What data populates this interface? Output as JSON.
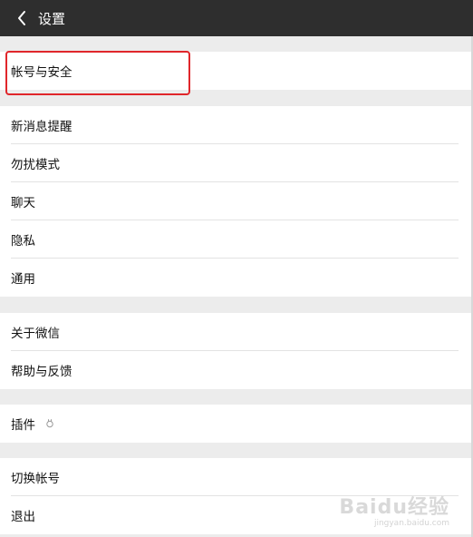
{
  "header": {
    "title": "设置",
    "back_icon": "chevron-left-icon"
  },
  "groups": [
    {
      "items": [
        {
          "label": "帐号与安全"
        }
      ]
    },
    {
      "items": [
        {
          "label": "新消息提醒"
        },
        {
          "label": "勿扰模式"
        },
        {
          "label": "聊天"
        },
        {
          "label": "隐私"
        },
        {
          "label": "通用"
        }
      ]
    },
    {
      "items": [
        {
          "label": "关于微信"
        },
        {
          "label": "帮助与反馈"
        }
      ]
    },
    {
      "items": [
        {
          "label": "插件",
          "icon": "plugin-icon"
        }
      ]
    },
    {
      "items": [
        {
          "label": "切换帐号"
        },
        {
          "label": "退出"
        }
      ]
    }
  ],
  "watermark": {
    "main": "Baidu经验",
    "sub": "jingyan.baidu.com"
  },
  "colors": {
    "topbar": "#2e2e2e",
    "background": "#ececec",
    "highlight": "#e0262b"
  }
}
